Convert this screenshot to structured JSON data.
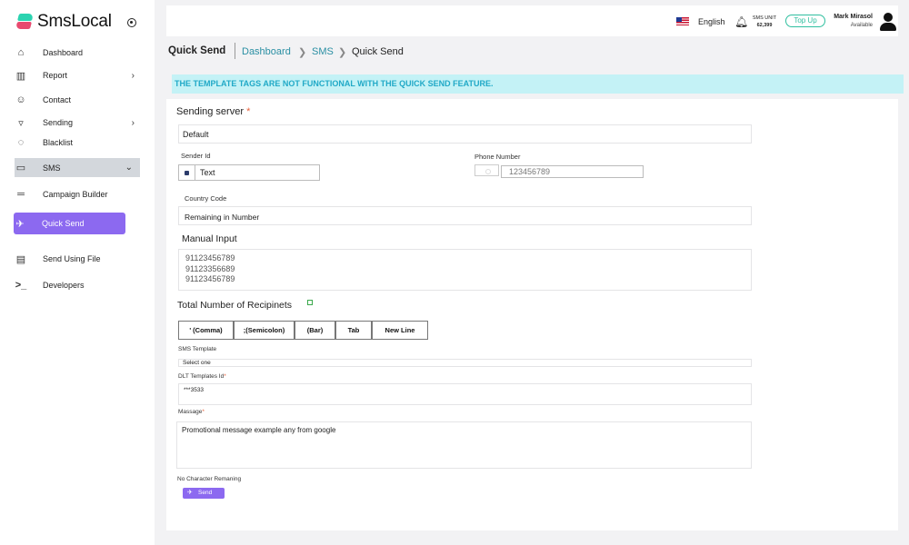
{
  "app": {
    "logo": "SmsLocal"
  },
  "sidebar": {
    "items": [
      {
        "label": "Dashboard",
        "icon": "home-icon"
      },
      {
        "label": "Report",
        "icon": "bar-chart-icon"
      },
      {
        "label": "Contact",
        "icon": "user-icon"
      },
      {
        "label": "Sending",
        "icon": "funnel-icon"
      },
      {
        "label": "Blacklist",
        "icon": "block-icon"
      },
      {
        "label": "SMS",
        "icon": "message-icon"
      },
      {
        "label": "Campaign Builder",
        "icon": "campaign-icon"
      },
      {
        "label": "Quick Send",
        "icon": "send-icon"
      },
      {
        "label": "Send Using File",
        "icon": "file-icon"
      },
      {
        "label": "Developers",
        "icon": "terminal-icon"
      }
    ]
  },
  "header": {
    "language": "English",
    "sms_unit_label": "SMS UNIT",
    "sms_unit_value": "62,399",
    "topup_label": "Top Up",
    "user_name": "Mark Mirasol",
    "user_status": "Available"
  },
  "page": {
    "title": "Quick Send",
    "breadcrumb": [
      "Dashboard",
      "SMS",
      "Quick Send"
    ]
  },
  "notice": "THE TEMPLATE TAGS ARE NOT FUNCTIONAL WITH THE QUICK SEND FEATURE.",
  "form": {
    "sending_server_label": "Sending server",
    "sending_server_value": "Default",
    "sender_id_label": "Sender Id",
    "sender_id_value": "Text",
    "phone_label": "Phone Number",
    "phone_placeholder": "123456789",
    "country_code_label": "Country Code",
    "country_code_value": "Remaining in Number",
    "manual_input_label": "Manual Input",
    "manual_input_lines": [
      "91123456789",
      "91123356689",
      "91123456789"
    ],
    "total_recipients_label": "Total Number of Recipinets",
    "separators": [
      "' (Comma)",
      ";(Semicolon)",
      "(Bar)",
      "Tab",
      "New Line"
    ],
    "sms_template_label": "SMS Template",
    "sms_template_value": "Select one",
    "dlt_label": "DLT Templates Id",
    "dlt_value": "***3533",
    "message_label": "Massage",
    "message_value": "Promotional message example any from google",
    "char_remaining": "No Character Remaning",
    "send_label": "Send"
  },
  "colors": {
    "accent": "#8c69f0",
    "notice_bg": "#c4f2f6",
    "notice_text": "#21a9c7",
    "link": "#2a8fa3",
    "topup": "#2fbf9f"
  }
}
